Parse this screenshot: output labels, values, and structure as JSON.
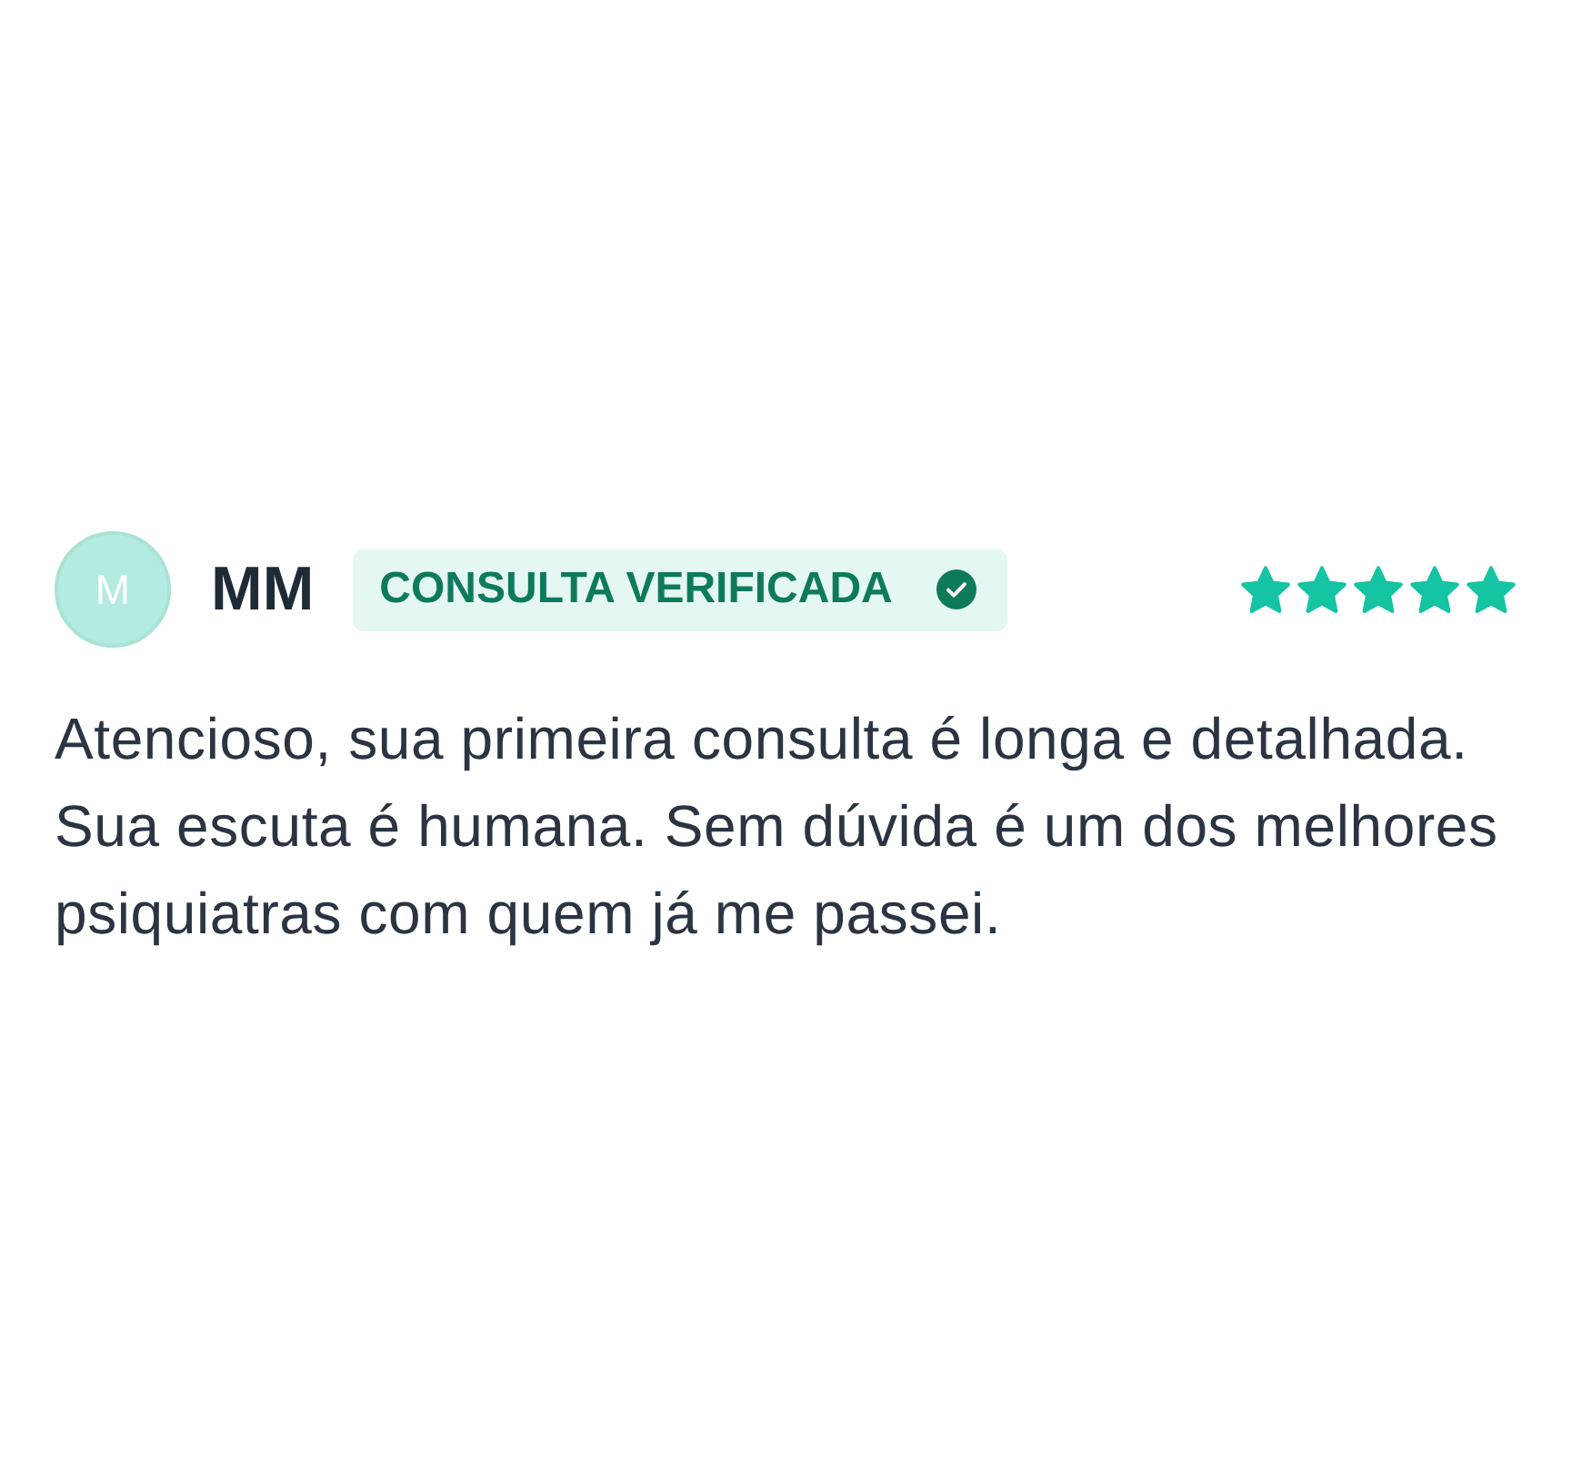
{
  "review": {
    "avatar_initial": "M",
    "name": "MM",
    "badge": "CONSULTA VERIFICADA",
    "stars": 5
  },
  "comment": "Atencioso, sua primeira consulta é longa e detalhada. Sua escuta é humana. Sem dúvida é um dos melhores psiquiatras com quem já me passei."
}
